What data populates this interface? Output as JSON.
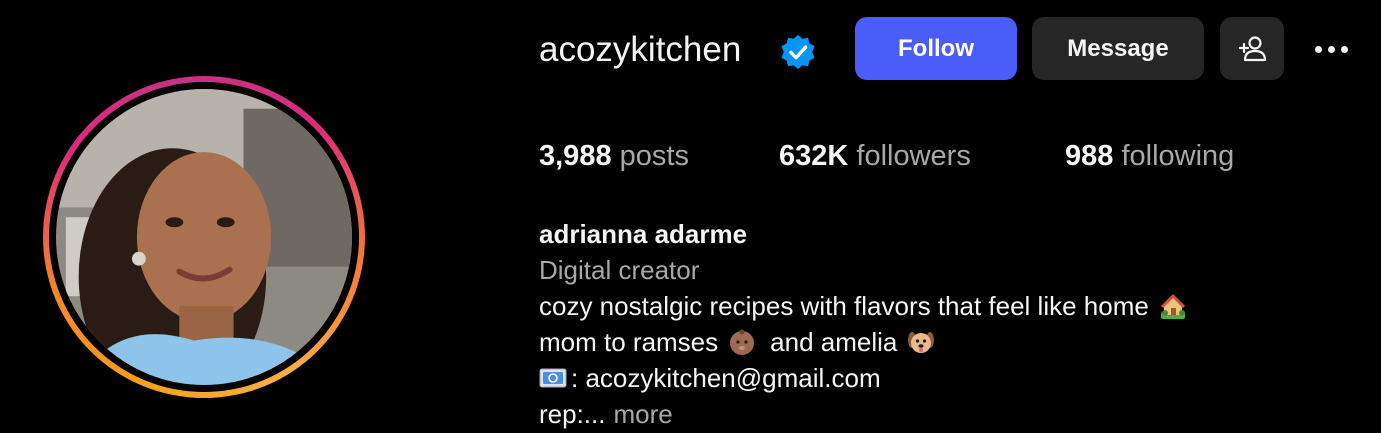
{
  "profile": {
    "username": "acozykitchen",
    "verified": true,
    "display_name": "adrianna adarme",
    "category": "Digital creator"
  },
  "actions": {
    "follow_label": "Follow",
    "message_label": "Message",
    "add_user_glyph": "+",
    "more_icon": "more-horizontal-icon"
  },
  "stats": {
    "posts_count": "3,988",
    "posts_label": "posts",
    "followers_count": "632K",
    "followers_label": "followers",
    "following_count": "988",
    "following_label": "following"
  },
  "bio": {
    "line1": "cozy nostalgic recipes with flavors that feel like home",
    "line1_emoji": "house-with-garden-emoji",
    "line2_a": "mom to ramses",
    "line2_emoji_a": "baby-emoji",
    "line2_b": "and amelia",
    "line2_emoji_b": "dog-face-emoji",
    "line3_emoji": "email-emoji",
    "line3": ": acozykitchen@gmail.com",
    "line4": "rep:...",
    "more_label": "more"
  },
  "colors": {
    "accent": "#4a5df9",
    "verified": "#0095f6",
    "button_secondary": "#262626",
    "muted_text": "#a8a8a8"
  }
}
